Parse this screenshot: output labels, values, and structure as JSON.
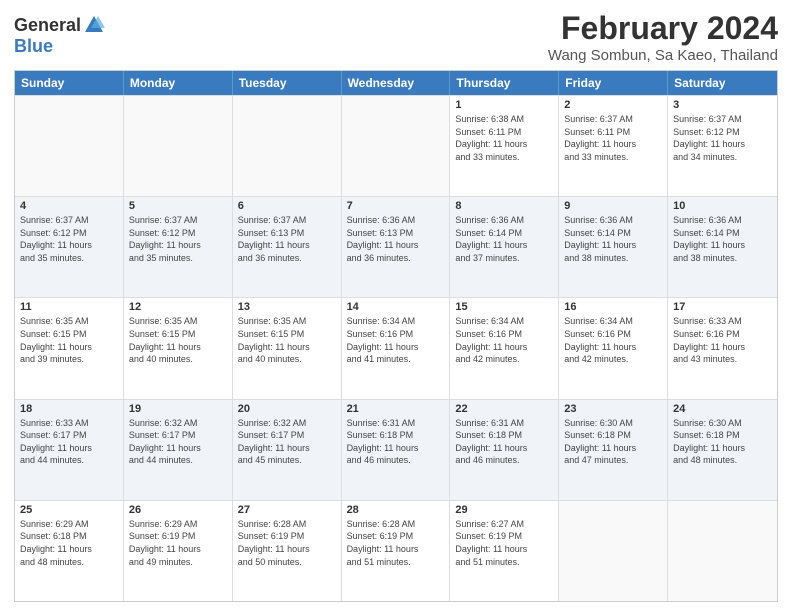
{
  "header": {
    "logo_general": "General",
    "logo_blue": "Blue",
    "title": "February 2024",
    "location": "Wang Sombun, Sa Kaeo, Thailand"
  },
  "days_of_week": [
    "Sunday",
    "Monday",
    "Tuesday",
    "Wednesday",
    "Thursday",
    "Friday",
    "Saturday"
  ],
  "weeks": [
    [
      {
        "day": "",
        "info": ""
      },
      {
        "day": "",
        "info": ""
      },
      {
        "day": "",
        "info": ""
      },
      {
        "day": "",
        "info": ""
      },
      {
        "day": "1",
        "info": "Sunrise: 6:38 AM\nSunset: 6:11 PM\nDaylight: 11 hours\nand 33 minutes."
      },
      {
        "day": "2",
        "info": "Sunrise: 6:37 AM\nSunset: 6:11 PM\nDaylight: 11 hours\nand 33 minutes."
      },
      {
        "day": "3",
        "info": "Sunrise: 6:37 AM\nSunset: 6:12 PM\nDaylight: 11 hours\nand 34 minutes."
      }
    ],
    [
      {
        "day": "4",
        "info": "Sunrise: 6:37 AM\nSunset: 6:12 PM\nDaylight: 11 hours\nand 35 minutes."
      },
      {
        "day": "5",
        "info": "Sunrise: 6:37 AM\nSunset: 6:12 PM\nDaylight: 11 hours\nand 35 minutes."
      },
      {
        "day": "6",
        "info": "Sunrise: 6:37 AM\nSunset: 6:13 PM\nDaylight: 11 hours\nand 36 minutes."
      },
      {
        "day": "7",
        "info": "Sunrise: 6:36 AM\nSunset: 6:13 PM\nDaylight: 11 hours\nand 36 minutes."
      },
      {
        "day": "8",
        "info": "Sunrise: 6:36 AM\nSunset: 6:14 PM\nDaylight: 11 hours\nand 37 minutes."
      },
      {
        "day": "9",
        "info": "Sunrise: 6:36 AM\nSunset: 6:14 PM\nDaylight: 11 hours\nand 38 minutes."
      },
      {
        "day": "10",
        "info": "Sunrise: 6:36 AM\nSunset: 6:14 PM\nDaylight: 11 hours\nand 38 minutes."
      }
    ],
    [
      {
        "day": "11",
        "info": "Sunrise: 6:35 AM\nSunset: 6:15 PM\nDaylight: 11 hours\nand 39 minutes."
      },
      {
        "day": "12",
        "info": "Sunrise: 6:35 AM\nSunset: 6:15 PM\nDaylight: 11 hours\nand 40 minutes."
      },
      {
        "day": "13",
        "info": "Sunrise: 6:35 AM\nSunset: 6:15 PM\nDaylight: 11 hours\nand 40 minutes."
      },
      {
        "day": "14",
        "info": "Sunrise: 6:34 AM\nSunset: 6:16 PM\nDaylight: 11 hours\nand 41 minutes."
      },
      {
        "day": "15",
        "info": "Sunrise: 6:34 AM\nSunset: 6:16 PM\nDaylight: 11 hours\nand 42 minutes."
      },
      {
        "day": "16",
        "info": "Sunrise: 6:34 AM\nSunset: 6:16 PM\nDaylight: 11 hours\nand 42 minutes."
      },
      {
        "day": "17",
        "info": "Sunrise: 6:33 AM\nSunset: 6:16 PM\nDaylight: 11 hours\nand 43 minutes."
      }
    ],
    [
      {
        "day": "18",
        "info": "Sunrise: 6:33 AM\nSunset: 6:17 PM\nDaylight: 11 hours\nand 44 minutes."
      },
      {
        "day": "19",
        "info": "Sunrise: 6:32 AM\nSunset: 6:17 PM\nDaylight: 11 hours\nand 44 minutes."
      },
      {
        "day": "20",
        "info": "Sunrise: 6:32 AM\nSunset: 6:17 PM\nDaylight: 11 hours\nand 45 minutes."
      },
      {
        "day": "21",
        "info": "Sunrise: 6:31 AM\nSunset: 6:18 PM\nDaylight: 11 hours\nand 46 minutes."
      },
      {
        "day": "22",
        "info": "Sunrise: 6:31 AM\nSunset: 6:18 PM\nDaylight: 11 hours\nand 46 minutes."
      },
      {
        "day": "23",
        "info": "Sunrise: 6:30 AM\nSunset: 6:18 PM\nDaylight: 11 hours\nand 47 minutes."
      },
      {
        "day": "24",
        "info": "Sunrise: 6:30 AM\nSunset: 6:18 PM\nDaylight: 11 hours\nand 48 minutes."
      }
    ],
    [
      {
        "day": "25",
        "info": "Sunrise: 6:29 AM\nSunset: 6:18 PM\nDaylight: 11 hours\nand 48 minutes."
      },
      {
        "day": "26",
        "info": "Sunrise: 6:29 AM\nSunset: 6:19 PM\nDaylight: 11 hours\nand 49 minutes."
      },
      {
        "day": "27",
        "info": "Sunrise: 6:28 AM\nSunset: 6:19 PM\nDaylight: 11 hours\nand 50 minutes."
      },
      {
        "day": "28",
        "info": "Sunrise: 6:28 AM\nSunset: 6:19 PM\nDaylight: 11 hours\nand 51 minutes."
      },
      {
        "day": "29",
        "info": "Sunrise: 6:27 AM\nSunset: 6:19 PM\nDaylight: 11 hours\nand 51 minutes."
      },
      {
        "day": "",
        "info": ""
      },
      {
        "day": "",
        "info": ""
      }
    ]
  ]
}
